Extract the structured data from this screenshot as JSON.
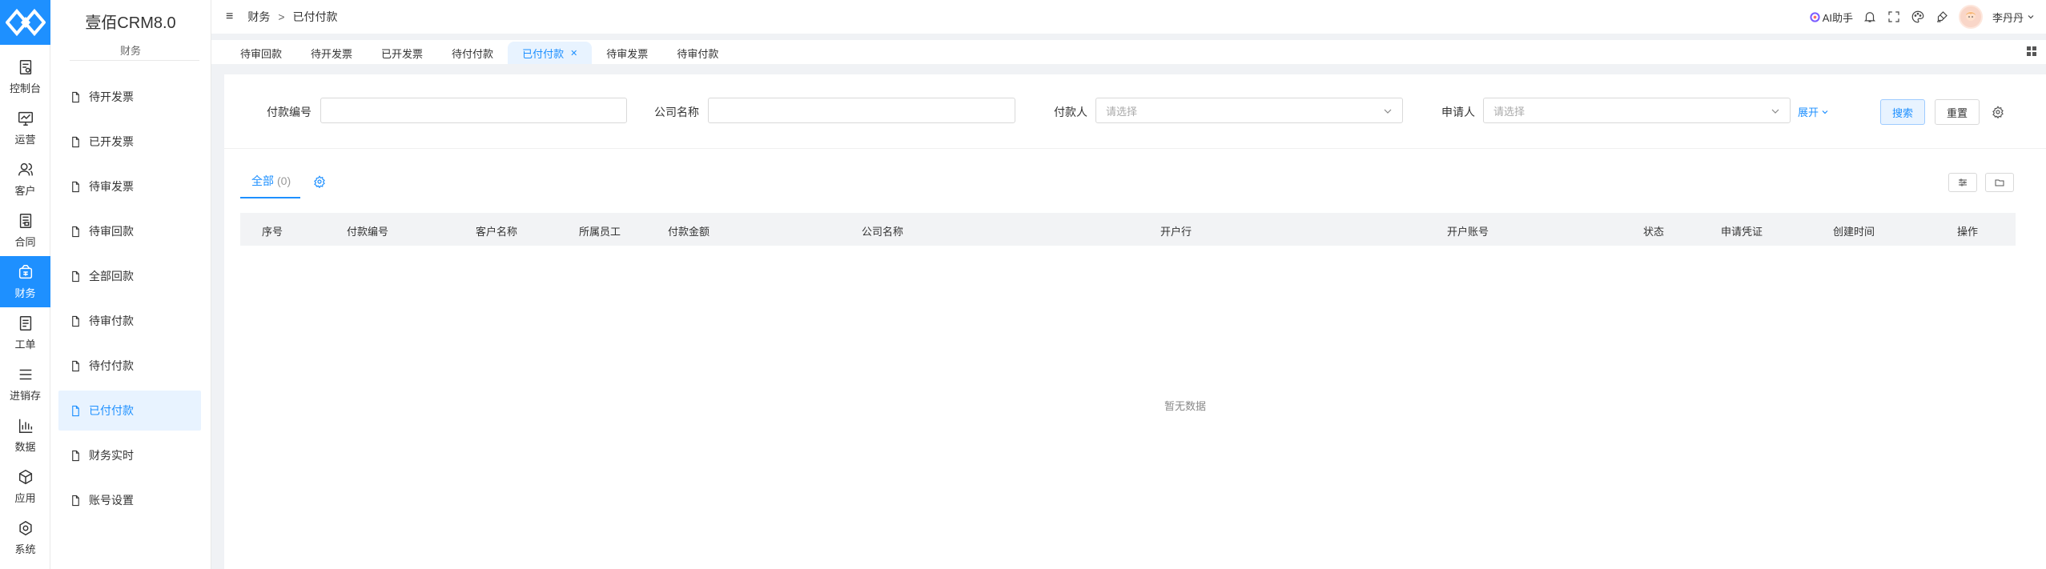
{
  "brand": "壹佰CRM8.0",
  "rail": [
    {
      "label": "控制台",
      "icon": "dashboard-icon"
    },
    {
      "label": "运营",
      "icon": "chart-monitor-icon"
    },
    {
      "label": "客户",
      "icon": "users-icon"
    },
    {
      "label": "合同",
      "icon": "contract-icon"
    },
    {
      "label": "财务",
      "icon": "wallet-icon",
      "active": true
    },
    {
      "label": "工单",
      "icon": "ticket-icon"
    },
    {
      "label": "进销存",
      "icon": "list-icon"
    },
    {
      "label": "数据",
      "icon": "bar-chart-icon"
    },
    {
      "label": "应用",
      "icon": "cube-icon"
    },
    {
      "label": "系统",
      "icon": "settings-icon"
    }
  ],
  "subnav": {
    "section": "财务",
    "items": [
      {
        "label": "待开发票"
      },
      {
        "label": "已开发票"
      },
      {
        "label": "待审发票"
      },
      {
        "label": "待审回款"
      },
      {
        "label": "全部回款"
      },
      {
        "label": "待审付款"
      },
      {
        "label": "待付付款"
      },
      {
        "label": "已付付款",
        "active": true
      },
      {
        "label": "财务实时"
      },
      {
        "label": "账号设置"
      }
    ]
  },
  "header": {
    "breadcrumb": [
      "财务",
      "已付付款"
    ],
    "breadcrumb_sep": ">",
    "ai_label": "AI助手",
    "user_name": "李丹丹"
  },
  "tabs": [
    {
      "label": "待审回款"
    },
    {
      "label": "待开发票"
    },
    {
      "label": "已开发票"
    },
    {
      "label": "待付付款"
    },
    {
      "label": "已付付款",
      "active": true,
      "closable": true
    },
    {
      "label": "待审发票"
    },
    {
      "label": "待审付款"
    }
  ],
  "filters": {
    "payment_no_label": "付款编号",
    "company_label": "公司名称",
    "payer_label": "付款人",
    "payer_placeholder": "请选择",
    "applicant_label": "申请人",
    "applicant_placeholder": "请选择",
    "expand_label": "展开",
    "search_label": "搜索",
    "reset_label": "重置"
  },
  "subtab": {
    "label": "全部",
    "count": "(0)"
  },
  "table": {
    "columns": [
      "序号",
      "付款编号",
      "客户名称",
      "所属员工",
      "付款金额",
      "公司名称",
      "开户行",
      "开户账号",
      "状态",
      "申请凭证",
      "创建时间",
      "操作"
    ],
    "empty_text": "暂无数据"
  },
  "colors": {
    "accent": "#1e90ff",
    "accent_bg": "#e8f3ff"
  }
}
